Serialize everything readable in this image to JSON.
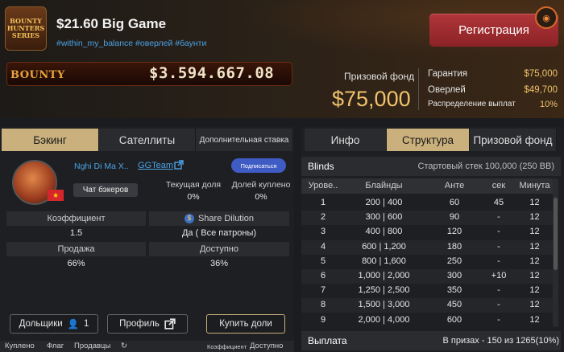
{
  "header": {
    "logo_lines": [
      "BOUNTY",
      "HUNTERS",
      "SERIES"
    ],
    "title": "$21.60 Big Game",
    "tags": "#within_my_balance #оверлей #баунти",
    "register_label": "Регистрация",
    "bounty_label": "BOUNTY",
    "bounty_amount": "$3.594.667.08",
    "prize_fund_label": "Призовой фонд",
    "prize_fund_value": "$75,000",
    "guarantee_label": "Гарантия",
    "guarantee_value": "$75,000",
    "overlay_label": "Оверлей",
    "overlay_value": "$49,700",
    "payout_dist_label": "Распределение выплат",
    "payout_dist_value": "10%"
  },
  "left": {
    "tabs": [
      "Бэкинг",
      "Сателлиты",
      "Дополнительная ставка"
    ],
    "backer_name": "Nghi Di Ma X..",
    "team": "GGTeam",
    "subscribe_label": "Подписаться",
    "chat_label": "Чат бэкеров",
    "current_share_label": "Текущая доля",
    "current_share_value": "0%",
    "bought_share_label": "Долей куплено",
    "bought_share_value": "0%",
    "coef_label": "Коэффициент",
    "coef_value": "1.5",
    "dilution_label": "Share Dilution",
    "dilution_value": "Да ( Все патроны)",
    "sale_label": "Продажа",
    "sale_value": "66%",
    "available_label": "Доступно",
    "available_value": "36%",
    "shareholders_label": "Дольщики",
    "shareholders_count": "1",
    "profile_label": "Профиль",
    "buy_label": "Купить доли",
    "footer": {
      "bought": "Куплено",
      "flag": "Флаг",
      "sellers": "Продавцы",
      "coef": "Коэффициент",
      "available": "Доступно"
    }
  },
  "right": {
    "tabs": [
      "Инфо",
      "Структура",
      "Призовой фонд"
    ],
    "blinds_label": "Blinds",
    "start_stack": "Стартовый стек 100,000 (250 BB)",
    "columns": [
      "Урове..",
      "Блайнды",
      "Анте",
      "сек",
      "Минута"
    ],
    "rows": [
      [
        "1",
        "200 | 400",
        "60",
        "45",
        "12"
      ],
      [
        "2",
        "300 | 600",
        "90",
        "-",
        "12"
      ],
      [
        "3",
        "400 | 800",
        "120",
        "-",
        "12"
      ],
      [
        "4",
        "600 | 1,200",
        "180",
        "-",
        "12"
      ],
      [
        "5",
        "800 | 1,600",
        "250",
        "-",
        "12"
      ],
      [
        "6",
        "1,000 | 2,000",
        "300",
        "+10",
        "12"
      ],
      [
        "7",
        "1,250 | 2,500",
        "350",
        "-",
        "12"
      ],
      [
        "8",
        "1,500 | 3,000",
        "450",
        "-",
        "12"
      ],
      [
        "9",
        "2,000 | 4,000",
        "600",
        "-",
        "12"
      ]
    ],
    "payout_label": "Выплата",
    "payout_value": "В призах - 150 из 1265(10%)"
  }
}
